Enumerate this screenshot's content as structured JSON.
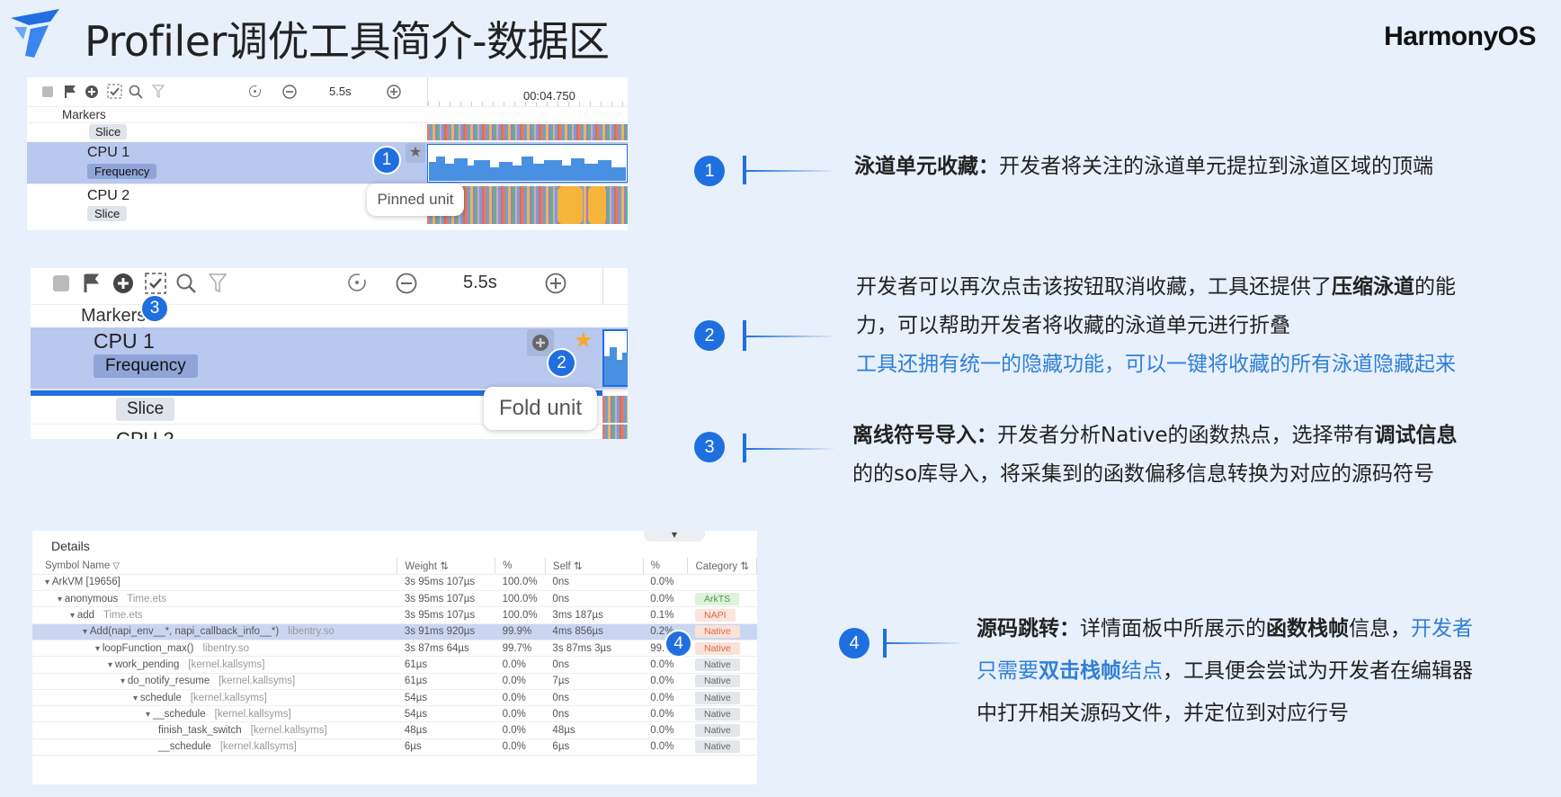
{
  "page": {
    "title": "Profiler调优工具简介-数据区",
    "brand": "HarmonyOS"
  },
  "panel1": {
    "zoom": "5.5s",
    "time": "00:04.750",
    "markers": "Markers",
    "slice_chip": "Slice",
    "cpu1": "CPU 1",
    "cpu1_chip": "Frequency",
    "cpu2": "CPU 2",
    "cpu2_chip": "Slice",
    "tooltip": "Pinned unit",
    "badge": "1"
  },
  "panel2": {
    "zoom": "5.5s",
    "markers": "Markers",
    "cpu1": "CPU 1",
    "cpu1_chip": "Frequency",
    "slice_chip": "Slice",
    "cpu2_partial": "CPU 2",
    "tooltip": "Fold unit",
    "badge2": "2",
    "badge3": "3"
  },
  "details": {
    "label": "Details",
    "columns": [
      "Symbol Name",
      "Weight",
      "%",
      "Self",
      "%",
      "Category"
    ],
    "rows": [
      {
        "indent": 0,
        "name": "ArkVM [19656]",
        "lib": "",
        "weight": "3s 95ms 107µs",
        "pct": "100.0%",
        "self": "0ns",
        "self_pct": "0.0%",
        "cat": ""
      },
      {
        "indent": 1,
        "name": "anonymous",
        "lib": "Time.ets",
        "weight": "3s 95ms 107µs",
        "pct": "100.0%",
        "self": "0ns",
        "self_pct": "0.0%",
        "cat": "ArkTS"
      },
      {
        "indent": 2,
        "name": "add",
        "lib": "Time.ets",
        "weight": "3s 95ms 107µs",
        "pct": "100.0%",
        "self": "3ms 187µs",
        "self_pct": "0.1%",
        "cat": "NAPI"
      },
      {
        "indent": 3,
        "name": "Add(napi_env__*, napi_callback_info__*)",
        "lib": "libentry.so",
        "weight": "3s 91ms 920µs",
        "pct": "99.9%",
        "self": "4ms 856µs",
        "self_pct": "0.2%",
        "cat": "Native",
        "highlight": true
      },
      {
        "indent": 4,
        "name": "loopFunction_max()",
        "lib": "libentry.so",
        "weight": "3s 87ms 64µs",
        "pct": "99.7%",
        "self": "3s 87ms 3µs",
        "self_pct": "99.7%",
        "cat": "Native",
        "hl_cat": true
      },
      {
        "indent": 5,
        "name": "work_pending",
        "lib": "[kernel.kallsyms]",
        "weight": "61µs",
        "pct": "0.0%",
        "self": "0ns",
        "self_pct": "0.0%",
        "cat": "Native"
      },
      {
        "indent": 6,
        "name": "do_notify_resume",
        "lib": "[kernel.kallsyms]",
        "weight": "61µs",
        "pct": "0.0%",
        "self": "7µs",
        "self_pct": "0.0%",
        "cat": "Native"
      },
      {
        "indent": 7,
        "name": "schedule",
        "lib": "[kernel.kallsyms]",
        "weight": "54µs",
        "pct": "0.0%",
        "self": "0ns",
        "self_pct": "0.0%",
        "cat": "Native"
      },
      {
        "indent": 8,
        "name": "__schedule",
        "lib": "[kernel.kallsyms]",
        "weight": "54µs",
        "pct": "0.0%",
        "self": "0ns",
        "self_pct": "0.0%",
        "cat": "Native"
      },
      {
        "indent": 9,
        "name": "finish_task_switch",
        "lib": "[kernel.kallsyms]",
        "weight": "48µs",
        "pct": "0.0%",
        "self": "48µs",
        "self_pct": "0.0%",
        "cat": "Native",
        "leaf": true
      },
      {
        "indent": 9,
        "name": "__schedule",
        "lib": "[kernel.kallsyms]",
        "weight": "6µs",
        "pct": "0.0%",
        "self": "6µs",
        "self_pct": "0.0%",
        "cat": "Native",
        "leaf": true
      }
    ],
    "badge": "4"
  },
  "callouts": {
    "c1": {
      "num": "1",
      "bold": "泳道单元收藏：",
      "text": "开发者将关注的泳道单元提拉到泳道区域的顶端"
    },
    "c2": {
      "num": "2",
      "line1a": "开发者可以再次点击该按钮取消收藏，工具还提供了",
      "line1b": "压缩泳道",
      "line1c": "的能",
      "line2": "力，可以帮助开发者将收藏的泳道单元进行折叠",
      "line3": "工具还拥有统一的隐藏功能，可以一键将收藏的所有泳道隐藏起来"
    },
    "c3": {
      "num": "3",
      "bold": "离线符号导入：",
      "line1": "开发者分析Native的函数热点，选择带有",
      "bold2": "调试信息",
      "line2": "的的so库导入，将采集到的函数偏移信息转换为对应的源码符号"
    },
    "c4": {
      "num": "4",
      "bold": "源码跳转：",
      "t1": "详情面板中所展示的",
      "b2": "函数栈帧",
      "t2": "信息，",
      "blue1": "开发者",
      "blue2": "只需要",
      "b3": "双击栈帧",
      "blue3": "结点",
      "t3": "，工具便会尝试为开发者在编辑器",
      "t4": "中打开相关源码文件，并定位到对应行号"
    }
  },
  "colors": {
    "accent": "#1f6fe0",
    "selected_row": "#b8c8ee",
    "link_blue": "#2f7fd8"
  }
}
